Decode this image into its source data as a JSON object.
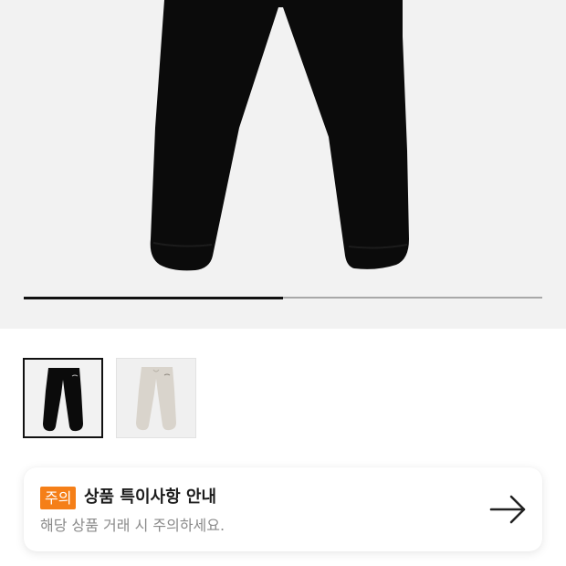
{
  "gallery": {
    "images": [
      "black-jogger-pants",
      "ivory-jogger-pants"
    ],
    "selected_index": 0,
    "progress": 0.5
  },
  "notice": {
    "badge": "주의",
    "title": "상품 특이사항 안내",
    "description": "해당 상품 거래 시 주의하세요.",
    "arrow_icon": "arrow-right-icon"
  },
  "colors": {
    "badge": "#f57f18",
    "hero_background": "#f2f2f2"
  }
}
